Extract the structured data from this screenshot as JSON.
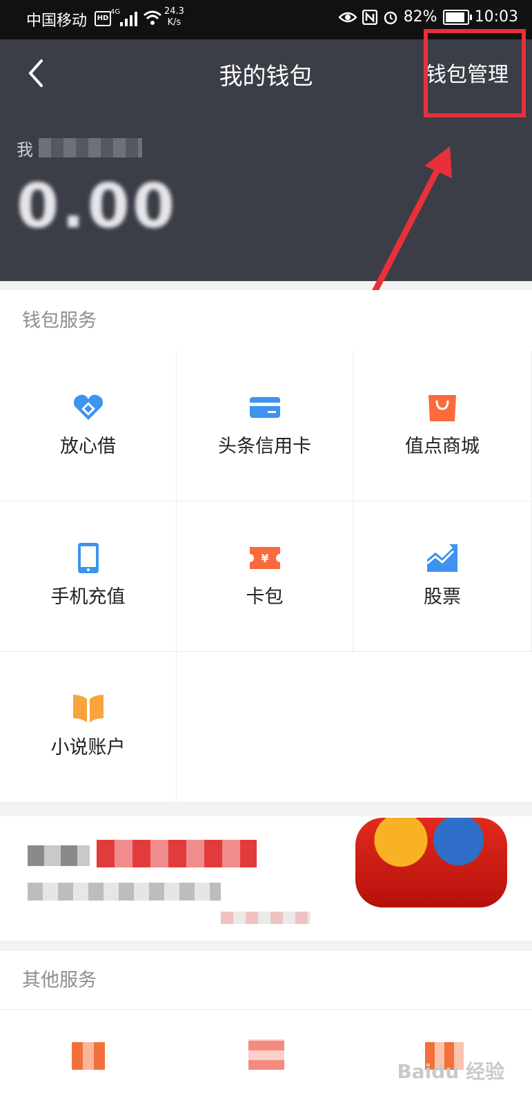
{
  "status_bar": {
    "carrier": "中国移动",
    "hd": "HD",
    "network": "4G",
    "speed_value": "24.3",
    "speed_unit": "K/s",
    "battery": "82%",
    "time": "10:03"
  },
  "header": {
    "title": "我的钱包",
    "manage_label": "钱包管理",
    "balance_label": "我",
    "balance_value": "0.00"
  },
  "wallet_services": {
    "title": "钱包服务",
    "items": [
      {
        "label": "放心借",
        "icon": "heart-coin-icon",
        "color": "#3d93ee"
      },
      {
        "label": "头条信用卡",
        "icon": "credit-card-icon",
        "color": "#3d93ee"
      },
      {
        "label": "值点商城",
        "icon": "shopping-bag-icon",
        "color": "#f96a3c"
      },
      {
        "label": "手机充值",
        "icon": "phone-icon",
        "color": "#3d93ee"
      },
      {
        "label": "卡包",
        "icon": "ticket-icon",
        "color": "#f96a3c"
      },
      {
        "label": "股票",
        "icon": "stock-chart-icon",
        "color": "#3d93ee"
      },
      {
        "label": "小说账户",
        "icon": "book-icon",
        "color": "#f9a43c"
      }
    ]
  },
  "other_services": {
    "title": "其他服务"
  },
  "watermark": "Baidu 经验"
}
